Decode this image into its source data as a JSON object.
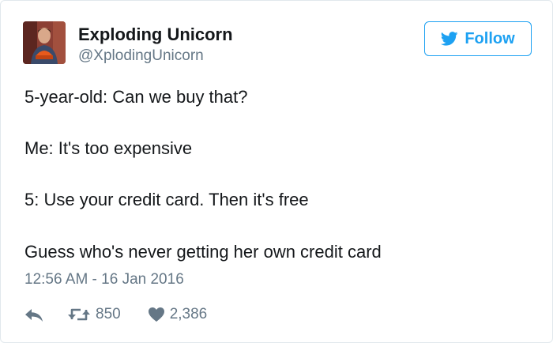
{
  "author": {
    "name": "Exploding Unicorn",
    "handle": "@XplodingUnicorn"
  },
  "follow": {
    "label": "Follow"
  },
  "tweet": {
    "lines": [
      "5-year-old: Can we buy that?",
      "Me: It's too expensive",
      "5: Use your credit card. Then it's free",
      "Guess who's never getting her own credit card"
    ],
    "timestamp": "12:56 AM - 16 Jan 2016"
  },
  "actions": {
    "retweets": "850",
    "likes": "2,386"
  },
  "colors": {
    "accent": "#1da1f2",
    "text": "#14171a",
    "muted": "#657786",
    "border": "#e1e8ed"
  },
  "icons": {
    "follow": "twitter-bird-icon",
    "reply": "reply-icon",
    "retweet": "retweet-icon",
    "like": "heart-icon"
  }
}
